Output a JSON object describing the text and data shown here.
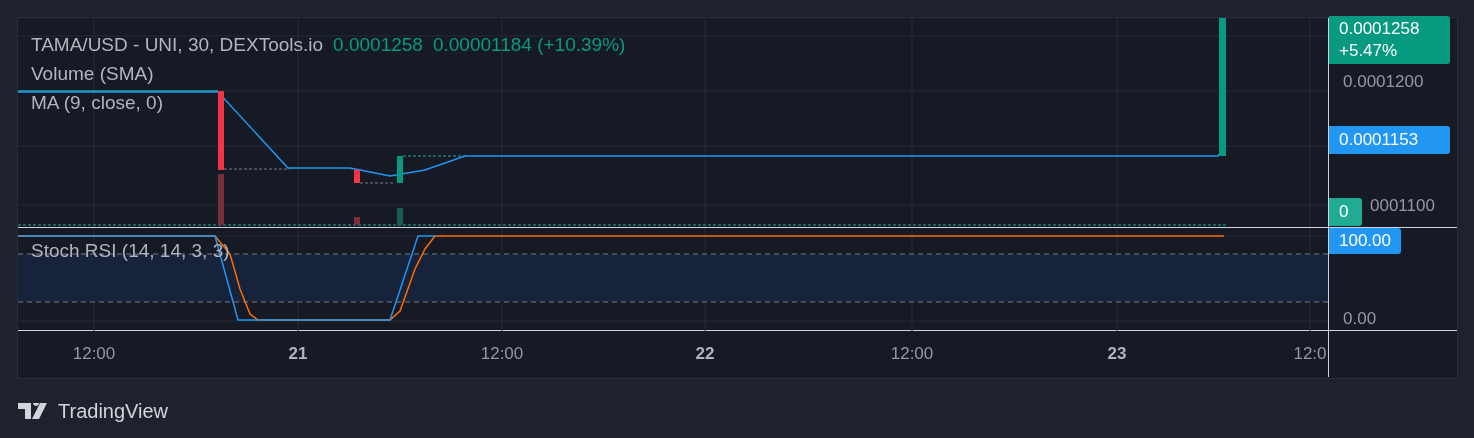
{
  "legend": {
    "symbol": "TAMA/USD - UNI, 30, DEXTools.io",
    "price": "0.0001258",
    "change": "0.00001184 (+10.39%)",
    "indicators": [
      "Volume (SMA)",
      "MA (9, close, 0)"
    ]
  },
  "price_scale": [
    {
      "kind": "last",
      "text": "0.0001258",
      "subtext": "+5.47%"
    },
    {
      "kind": "tick",
      "text": "0.0001200"
    },
    {
      "kind": "ma",
      "text": "0.0001153"
    },
    {
      "kind": "volume",
      "text": "0"
    },
    {
      "kind": "tick",
      "text": "0001100"
    }
  ],
  "stoch_pane": {
    "label": "Stoch RSI (14, 14, 3, 3)",
    "scale": [
      {
        "kind": "value",
        "text": "100.00"
      },
      {
        "kind": "tick",
        "text": "0.00"
      }
    ]
  },
  "time_axis": [
    {
      "kind": "time",
      "text": "12:00"
    },
    {
      "kind": "day",
      "text": "21"
    },
    {
      "kind": "time",
      "text": "12:00"
    },
    {
      "kind": "day",
      "text": "22"
    },
    {
      "kind": "time",
      "text": "12:00"
    },
    {
      "kind": "day",
      "text": "23"
    },
    {
      "kind": "time",
      "text": "12:0"
    }
  ],
  "footer": {
    "brand": "TradingView"
  }
}
